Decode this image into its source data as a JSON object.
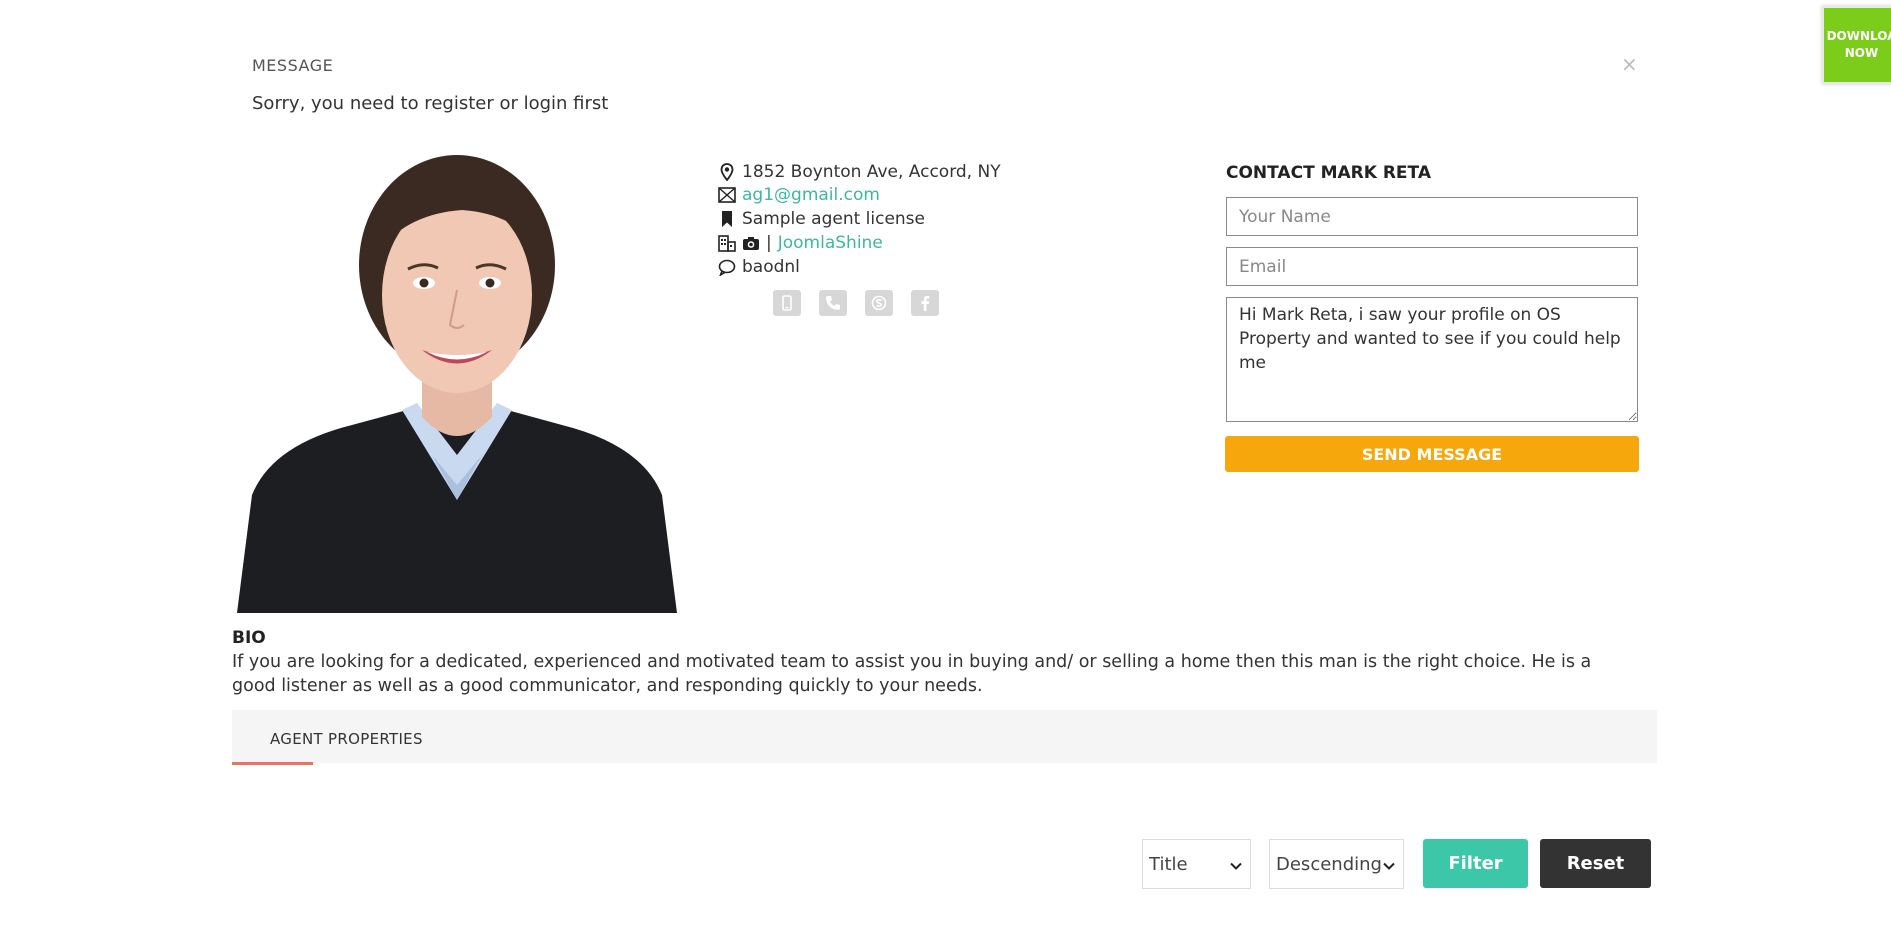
{
  "message": {
    "title": "MESSAGE",
    "text": "Sorry, you need to register or login first",
    "close": "×"
  },
  "download_badge": {
    "label_line1": "DOWNLOA",
    "label_line2": "NOW"
  },
  "agent": {
    "address": "1852 Boynton Ave, Accord, NY",
    "email": "ag1@gmail.com",
    "license": "Sample agent license",
    "separator": "|",
    "company": "JoomlaShine",
    "skype": "baodnl",
    "social_icons": [
      "mobile-icon",
      "phone-icon",
      "skype-icon",
      "facebook-icon"
    ]
  },
  "contact": {
    "title": "CONTACT MARK RETA",
    "name_placeholder": "Your Name",
    "email_placeholder": "Email",
    "message_value": "Hi Mark Reta, i saw your profile on OS Property and wanted to see if you could help me",
    "send_label": "SEND MESSAGE"
  },
  "bio": {
    "heading": "BIO",
    "text": "If you are looking for a dedicated, experienced and motivated team to assist you in buying and/ or selling a home then this man is the right choice. He is a good listener as well as a good communicator, and responding quickly to your needs."
  },
  "tabs": {
    "agent_properties": "AGENT PROPERTIES"
  },
  "filter": {
    "sort_by": "Title",
    "order": "Descending",
    "filter_label": "Filter",
    "reset_label": "Reset"
  },
  "colors": {
    "accent_teal": "#3cb8a0",
    "send_orange": "#f5a70b",
    "download_green": "#7ccc1c",
    "tab_underline": "#e8735f",
    "reset_dark": "#333333"
  }
}
